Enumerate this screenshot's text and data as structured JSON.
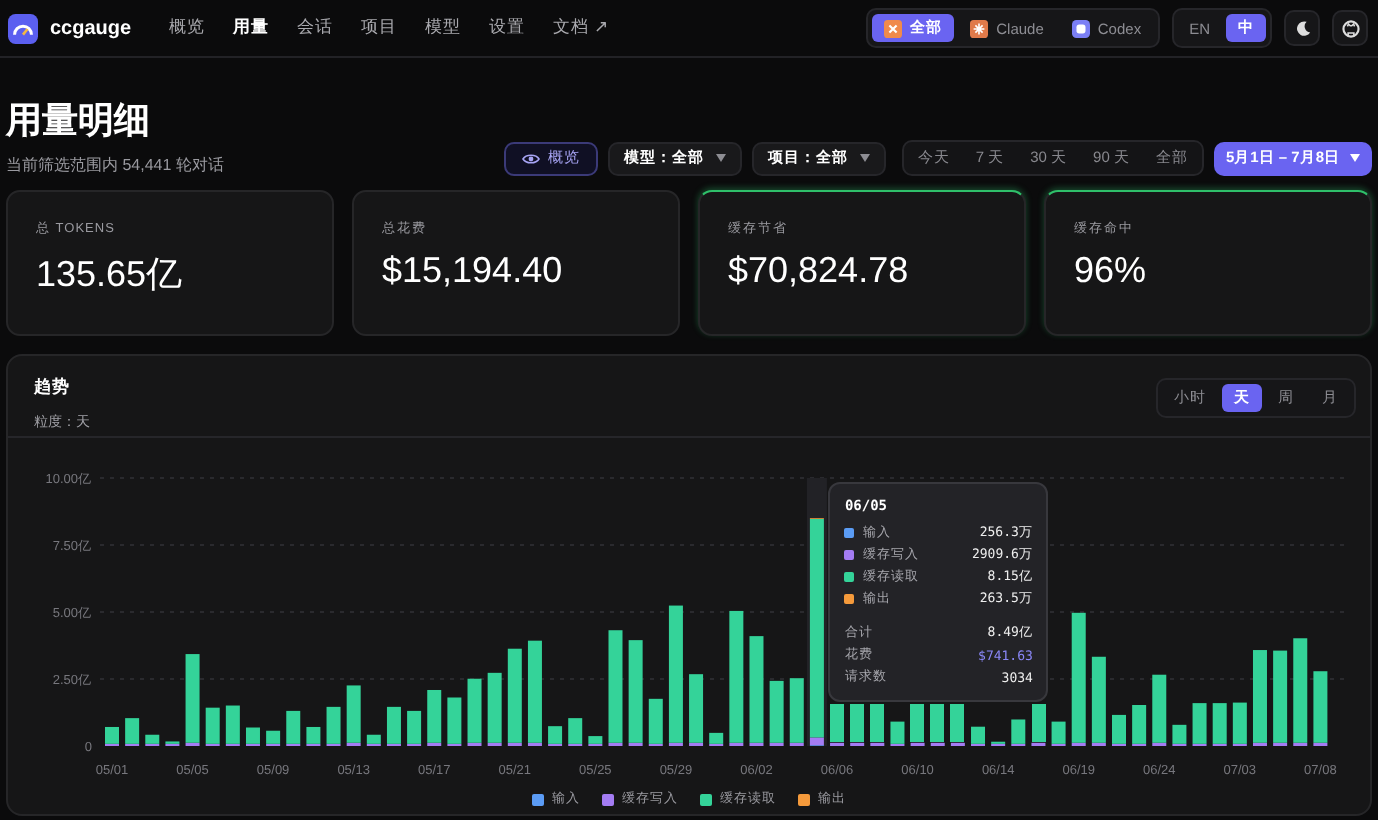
{
  "brand": {
    "name": "ccgauge"
  },
  "nav": [
    {
      "label": "概览",
      "selected": false
    },
    {
      "label": "用量",
      "selected": true
    },
    {
      "label": "会话",
      "selected": false
    },
    {
      "label": "项目",
      "selected": false
    },
    {
      "label": "模型",
      "selected": false
    },
    {
      "label": "设置",
      "selected": false
    },
    {
      "label": "文档 ↗",
      "selected": false
    }
  ],
  "sources": [
    {
      "label": "全部",
      "kind": "all",
      "selected": true
    },
    {
      "label": "Claude",
      "kind": "claude",
      "selected": false
    },
    {
      "label": "Codex",
      "kind": "codex",
      "selected": false
    }
  ],
  "languages": [
    {
      "label": "EN",
      "selected": false
    },
    {
      "label": "中",
      "selected": true
    }
  ],
  "page": {
    "title": "用量明细",
    "subtitle": "当前筛选范围内 54,441 轮对话"
  },
  "filters": {
    "overview": "概览",
    "model": "模型：全部",
    "project": "项目：全部",
    "ranges": [
      {
        "label": "今天",
        "selected": false
      },
      {
        "label": "7 天",
        "selected": false
      },
      {
        "label": "30 天",
        "selected": false
      },
      {
        "label": "90 天",
        "selected": false
      },
      {
        "label": "全部",
        "selected": false
      }
    ],
    "date_range": {
      "label": "5月1日 – 7月8日",
      "selected": true
    }
  },
  "stats": [
    {
      "label": "总 TOKENS",
      "value": "135.65亿",
      "highlight": false
    },
    {
      "label": "总花费",
      "value": "$15,194.40",
      "highlight": false
    },
    {
      "label": "缓存节省",
      "value": "$70,824.78",
      "highlight": true
    },
    {
      "label": "缓存命中",
      "value": "96%",
      "highlight": true
    }
  ],
  "trend": {
    "title": "趋势",
    "subtitle": "粒度：天",
    "granularity": [
      {
        "label": "小时",
        "selected": false
      },
      {
        "label": "天",
        "selected": true
      },
      {
        "label": "周",
        "selected": false
      },
      {
        "label": "月",
        "selected": false
      }
    ],
    "tooltip": {
      "title": "06/05",
      "items": [
        {
          "label": "输入",
          "value": "256.3万",
          "color": "#5b9cf5"
        },
        {
          "label": "缓存写入",
          "value": "2909.6万",
          "color": "#a47cf3"
        },
        {
          "label": "缓存读取",
          "value": "8.15亿",
          "color": "#34d399"
        },
        {
          "label": "输出",
          "value": "263.5万",
          "color": "#f59a3b"
        }
      ],
      "summary": [
        {
          "label": "合计",
          "value": "8.49亿",
          "kind": "plain"
        },
        {
          "label": "花费",
          "value": "$741.63",
          "kind": "cost"
        },
        {
          "label": "请求数",
          "value": "3034",
          "kind": "plain"
        }
      ]
    },
    "chart_data": {
      "type": "bar",
      "stacked": true,
      "grid": true,
      "legend": true,
      "ylim": [
        0,
        10
      ],
      "yticks": [
        {
          "value": 0,
          "label": "0"
        },
        {
          "value": 2.5,
          "label": "2.50亿"
        },
        {
          "value": 5,
          "label": "5.00亿"
        },
        {
          "value": 7.5,
          "label": "7.50亿"
        },
        {
          "value": 10,
          "label": "10.00亿"
        }
      ],
      "categories": [
        "05/01",
        null,
        null,
        null,
        "05/05",
        null,
        null,
        null,
        "05/09",
        null,
        null,
        null,
        "05/13",
        null,
        null,
        null,
        "05/17",
        null,
        null,
        null,
        "05/21",
        null,
        null,
        null,
        "05/25",
        null,
        null,
        null,
        "05/29",
        null,
        null,
        null,
        "06/02",
        null,
        null,
        null,
        "06/06",
        null,
        null,
        null,
        "06/10",
        null,
        null,
        null,
        "06/14",
        null,
        null,
        null,
        "06/19",
        null,
        null,
        null,
        "06/24",
        null,
        null,
        null,
        "07/03",
        null,
        null,
        null,
        "07/08"
      ],
      "series": [
        {
          "name": "输入",
          "color": "#5b9cf5",
          "values": [
            null,
            null,
            null,
            null,
            null,
            null,
            null,
            null,
            null,
            null,
            null,
            null,
            null,
            null,
            null,
            null,
            null,
            null,
            null,
            null,
            null,
            null,
            null,
            null,
            null,
            null,
            null,
            null,
            null,
            null,
            null,
            null,
            null,
            null,
            null,
            0.03,
            null,
            null,
            null,
            null,
            null,
            null,
            null,
            null,
            null,
            null,
            null,
            null,
            null,
            null,
            null,
            null,
            null,
            null,
            null,
            null,
            null,
            null,
            null,
            null,
            null
          ]
        },
        {
          "name": "缓存写入",
          "color": "#a47cf3",
          "values": [
            0.08,
            0.08,
            0.08,
            0.08,
            0.12,
            0.08,
            0.08,
            0.08,
            0.08,
            0.08,
            0.08,
            0.08,
            0.12,
            0.08,
            0.08,
            0.08,
            0.12,
            0.08,
            0.12,
            0.12,
            0.12,
            0.12,
            0.08,
            0.08,
            0.08,
            0.12,
            0.12,
            0.08,
            0.12,
            0.12,
            0.08,
            0.12,
            0.12,
            0.12,
            0.12,
            0.29,
            0.12,
            0.12,
            0.12,
            0.08,
            0.12,
            0.12,
            0.12,
            0.08,
            0.08,
            0.08,
            0.12,
            0.08,
            0.12,
            0.12,
            0.08,
            0.08,
            0.12,
            0.08,
            0.08,
            0.08,
            0.08,
            0.12,
            0.12,
            0.12,
            0.12
          ]
        },
        {
          "name": "缓存读取",
          "color": "#34d399",
          "values": [
            0.63,
            0.96,
            0.34,
            0.09,
            3.31,
            1.35,
            1.43,
            0.61,
            0.49,
            1.23,
            0.63,
            1.38,
            2.14,
            0.34,
            1.38,
            1.23,
            1.97,
            1.73,
            2.39,
            2.61,
            3.51,
            3.81,
            0.66,
            0.96,
            0.29,
            4.2,
            3.83,
            1.68,
            5.12,
            2.56,
            0.41,
            4.92,
            3.98,
            2.31,
            2.41,
            8.15,
            null,
            null,
            null,
            0.83,
            null,
            null,
            null,
            0.64,
            0.08,
            0.91,
            null,
            0.83,
            4.85,
            3.21,
            1.08,
            1.45,
            2.54,
            0.71,
            1.52,
            1.52,
            1.54,
            3.46,
            3.44,
            3.9,
            2.67
          ]
        },
        {
          "name": "输出",
          "color": "#f59a3b",
          "values": [
            null,
            null,
            null,
            null,
            null,
            null,
            null,
            null,
            null,
            null,
            null,
            null,
            null,
            null,
            null,
            null,
            null,
            null,
            null,
            null,
            null,
            null,
            null,
            null,
            null,
            null,
            null,
            null,
            null,
            null,
            null,
            null,
            null,
            null,
            null,
            0.03,
            null,
            null,
            null,
            null,
            null,
            null,
            null,
            null,
            null,
            null,
            null,
            null,
            null,
            null,
            null,
            null,
            null,
            null,
            null,
            null,
            null,
            null,
            null,
            null,
            null
          ]
        }
      ]
    }
  }
}
